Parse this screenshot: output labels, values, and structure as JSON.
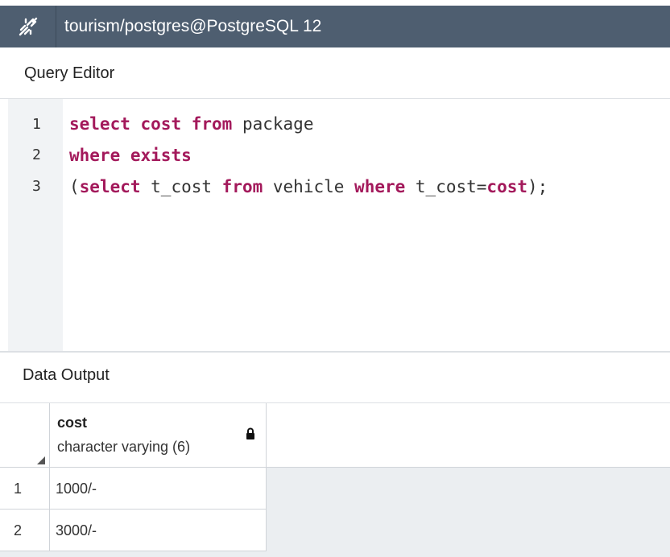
{
  "titlebar": {
    "icon": "unlinked-connection-icon",
    "title": "tourism/postgres@PostgreSQL 12"
  },
  "query_editor": {
    "label": "Query Editor",
    "line_numbers": [
      "1",
      "2",
      "3"
    ],
    "lines": [
      [
        {
          "t": "select",
          "c": "kw"
        },
        {
          "t": " ",
          "c": "plain"
        },
        {
          "t": "cost",
          "c": "kw"
        },
        {
          "t": " ",
          "c": "plain"
        },
        {
          "t": "from",
          "c": "kw"
        },
        {
          "t": " package",
          "c": "plain"
        }
      ],
      [
        {
          "t": "where",
          "c": "kw"
        },
        {
          "t": " ",
          "c": "plain"
        },
        {
          "t": "exists",
          "c": "kw"
        }
      ],
      [
        {
          "t": "(",
          "c": "plain"
        },
        {
          "t": "select",
          "c": "kw"
        },
        {
          "t": " t_cost ",
          "c": "plain"
        },
        {
          "t": "from",
          "c": "kw"
        },
        {
          "t": " vehicle ",
          "c": "plain"
        },
        {
          "t": "where",
          "c": "kw"
        },
        {
          "t": " t_cost=",
          "c": "plain"
        },
        {
          "t": "cost",
          "c": "kw"
        },
        {
          "t": ");",
          "c": "plain"
        }
      ]
    ]
  },
  "data_output": {
    "label": "Data Output",
    "column": {
      "name": "cost",
      "type": "character varying (6)",
      "icon": "lock-icon"
    },
    "rows": [
      {
        "num": "1",
        "value": "1000/-"
      },
      {
        "num": "2",
        "value": "3000/-"
      }
    ]
  },
  "colors": {
    "titlebar_bg": "#4e5e70",
    "keyword": "#a3195b",
    "gutter_bg": "#f1f3f5",
    "grid_bg": "#ebeef1"
  }
}
